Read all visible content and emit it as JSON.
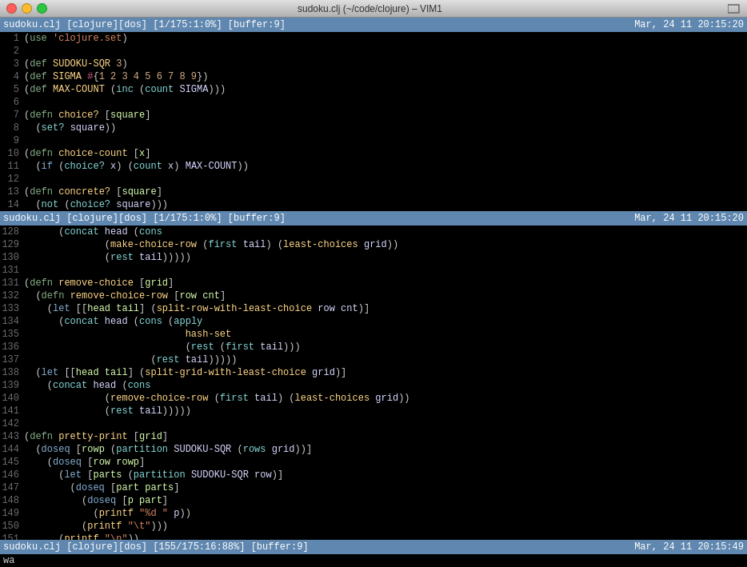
{
  "titleBar": {
    "title": "sudoku.clj (~/code/clojure) – VIM1",
    "closeLabel": "close",
    "minLabel": "minimize",
    "maxLabel": "maximize"
  },
  "topStatus": {
    "left": "sudoku.clj  [clojure][dos]  [1/175:1:0%]  [buffer:9]",
    "right": "Mar, 24 11  20:15:20"
  },
  "bottomStatus": {
    "left": "sudoku.clj  [clojure][dos]  [155/175:16:88%]  [buffer:9]",
    "right": "Mar, 24 11  20:15:49"
  },
  "cmdLine": "wa"
}
